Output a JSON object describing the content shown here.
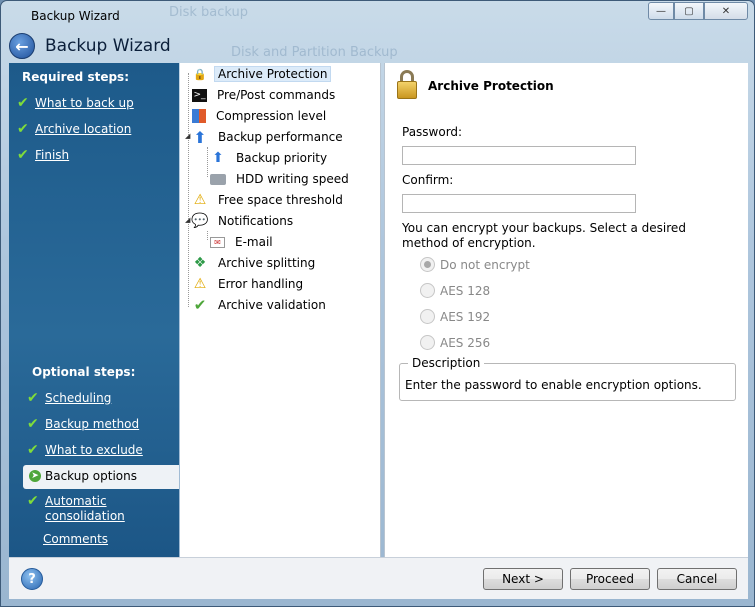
{
  "window": {
    "title": "Backup Wizard",
    "ghost_title": "Disk backup",
    "ghost_subtitle": "Disk and Partition Backup",
    "controls": {
      "minimize": "—",
      "maximize": "▢",
      "close": "✕"
    }
  },
  "header": {
    "title": "Backup Wizard",
    "back_icon": "back-arrow-icon"
  },
  "steps": {
    "required_heading": "Required steps:",
    "required": [
      {
        "label": "What to back up",
        "done": true
      },
      {
        "label": "Archive location",
        "done": true
      },
      {
        "label": "Finish",
        "done": true
      }
    ],
    "optional_heading": "Optional steps:",
    "optional": [
      {
        "label": "Scheduling",
        "done": true
      },
      {
        "label": "Backup method",
        "done": true
      },
      {
        "label": "What to exclude",
        "done": true
      },
      {
        "label": "Backup options",
        "current": true
      },
      {
        "label": "Automatic consolidation",
        "done": true
      },
      {
        "label": "Comments",
        "done": false
      }
    ]
  },
  "tree": {
    "items": [
      {
        "label": "Archive Protection",
        "icon": "lock-icon",
        "selected": true
      },
      {
        "label": "Pre/Post commands",
        "icon": "terminal-icon"
      },
      {
        "label": "Compression level",
        "icon": "compression-icon"
      },
      {
        "label": "Backup performance",
        "icon": "arrow-up-icon",
        "expandable": true
      },
      {
        "label": "Backup priority",
        "icon": "priority-icon",
        "child": true
      },
      {
        "label": "HDD writing speed",
        "icon": "hdd-icon",
        "child": true
      },
      {
        "label": "Free space threshold",
        "icon": "warning-icon"
      },
      {
        "label": "Notifications",
        "icon": "speech-bubble-icon",
        "expandable": true
      },
      {
        "label": "E-mail",
        "icon": "email-icon",
        "child": true
      },
      {
        "label": "Archive splitting",
        "icon": "split-icon"
      },
      {
        "label": "Error handling",
        "icon": "warning-icon"
      },
      {
        "label": "Archive validation",
        "icon": "check-icon"
      }
    ]
  },
  "content": {
    "title": "Archive Protection",
    "password_label": "Password:",
    "password_value": "",
    "confirm_label": "Confirm:",
    "confirm_value": "",
    "encrypt_text": "You can encrypt your backups. Select a desired method of encryption.",
    "radios": [
      {
        "label": "Do not encrypt",
        "checked": true
      },
      {
        "label": "AES 128",
        "checked": false
      },
      {
        "label": "AES 192",
        "checked": false
      },
      {
        "label": "AES 256",
        "checked": false
      }
    ],
    "description_legend": "Description",
    "description_text": "Enter the password to enable encryption options."
  },
  "footer": {
    "help": "?",
    "next": "Next >",
    "proceed": "Proceed",
    "cancel": "Cancel"
  },
  "colors": {
    "steps_bg": "#1d5a8a",
    "check_green": "#7fdc3a",
    "selection": "#dcebf9"
  }
}
